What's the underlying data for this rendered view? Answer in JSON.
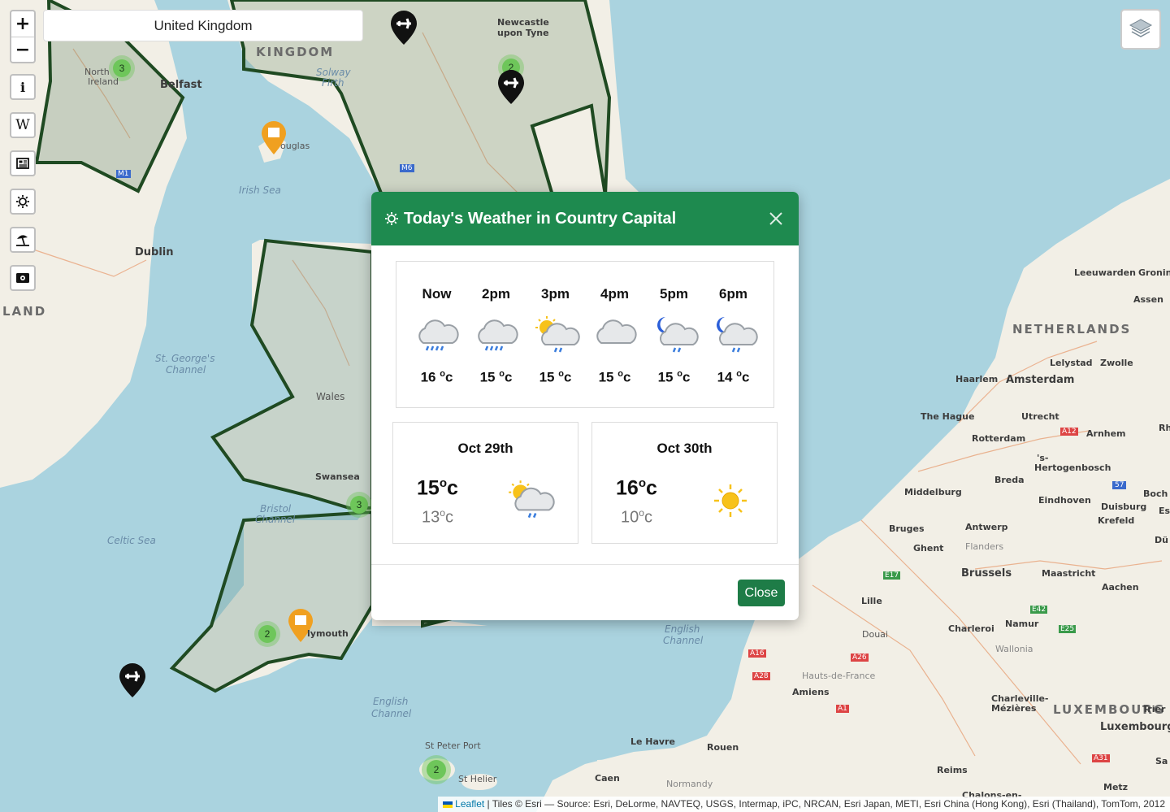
{
  "search": {
    "value": "United Kingdom"
  },
  "controls": {
    "zoom_in": "+",
    "zoom_out": "−",
    "info_label": "i",
    "wiki_label": "W"
  },
  "map_labels": {
    "kingdom": "KINGDOM",
    "land": "LAND",
    "netherlands": "NETHERLANDS",
    "luxembourg": "LUXEMBOURG",
    "newcastle_1": "Newcastle",
    "newcastle_2": "upon Tyne",
    "belfast": "Belfast",
    "north_ireland_1": "North",
    "north_ireland_2": "Ireland",
    "douglas": "ouglas",
    "solway_1": "Solway",
    "solway_2": "Firth",
    "irish_sea": "Irish Sea",
    "dublin": "Dublin",
    "st_georges_1": "St. George's",
    "st_georges_2": "Channel",
    "wales": "Wales",
    "swansea": "Swansea",
    "bristol_1": "Bristol",
    "bristol_2": "Channel",
    "celtic_sea": "Celtic Sea",
    "plymouth": "lymouth",
    "english_channel_1": "English",
    "english_channel_2": "Channel",
    "english_channel_b1": "English",
    "english_channel_b2": "Channel",
    "st_peter_port": "St Peter Port",
    "st_helier": "St Helier",
    "caen": "Caen",
    "le_havre": "Le Havre",
    "rouen": "Rouen",
    "normandy": "Normandy",
    "amiens": "Amiens",
    "hauts": "Hauts-de-France",
    "douai": "Douai",
    "lille": "Lille",
    "charleroi": "Charleroi",
    "namur": "Namur",
    "wallonia": "Wallonia",
    "reims": "Reims",
    "charleville_1": "Charleville-",
    "charleville_2": "Mézières",
    "chalons": "Chalons-en-",
    "metz": "Metz",
    "trier": "Trier",
    "luxembourg_city": "Luxembourg",
    "brussels": "Brussels",
    "maastricht": "Maastricht",
    "aachen": "Aachen",
    "bruges": "Bruges",
    "ghent": "Ghent",
    "flanders": "Flanders",
    "antwerp": "Antwerp",
    "middelburg": "Middelburg",
    "breda": "Breda",
    "eindhoven": "Eindhoven",
    "duisburg": "Duisburg",
    "krefeld": "Krefeld",
    "hertogenbosch_1": "'s-",
    "hertogenbosch_2": "Hertogenbosch",
    "rotterdam": "Rotterdam",
    "the_hague": "The Hague",
    "utrecht": "Utrecht",
    "arnhem": "Arnhem",
    "haarlem": "Haarlem",
    "amsterdam": "Amsterdam",
    "lelystad": "Lelystad",
    "zwolle": "Zwolle",
    "leeuwarden": "Leeuwarden",
    "groningen": "Gronin",
    "assen": "Assen",
    "boch": "Boch",
    "dus": "Dü",
    "rh": "Rh",
    "sa": "Sa",
    "es": "Es",
    "a12": "A12",
    "a16": "A16",
    "a26": "A26",
    "a28": "A28",
    "a1": "A1",
    "e17": "E17",
    "e42": "E42",
    "e25": "E25",
    "a31": "A31",
    "n57": "57",
    "m1": "M1",
    "m6": "M6"
  },
  "clusters": [
    {
      "count": "3"
    },
    {
      "count": "2"
    },
    {
      "count": "3"
    },
    {
      "count": "2"
    },
    {
      "count": "2"
    }
  ],
  "modal": {
    "title": "Today's Weather in Country Capital",
    "hourly": [
      {
        "time": "Now",
        "temp": "16",
        "unit": "c",
        "icon": "rain-cloud-icon"
      },
      {
        "time": "2pm",
        "temp": "15",
        "unit": "c",
        "icon": "rain-cloud-icon"
      },
      {
        "time": "3pm",
        "temp": "15",
        "unit": "c",
        "icon": "sun-cloud-rain-icon"
      },
      {
        "time": "4pm",
        "temp": "15",
        "unit": "c",
        "icon": "cloud-icon"
      },
      {
        "time": "5pm",
        "temp": "15",
        "unit": "c",
        "icon": "moon-cloud-rain-icon"
      },
      {
        "time": "6pm",
        "temp": "14",
        "unit": "c",
        "icon": "moon-cloud-rain-icon"
      }
    ],
    "days": [
      {
        "date": "Oct 29th",
        "high": "15",
        "low": "13",
        "unit": "c",
        "icon": "sun-cloud-rain-icon"
      },
      {
        "date": "Oct 30th",
        "high": "16",
        "low": "10",
        "unit": "c",
        "icon": "sun-icon"
      }
    ],
    "close_label": "Close"
  },
  "attribution": {
    "leaflet": "Leaflet",
    "text": "| Tiles © Esri — Source: Esri, DeLorme, NAVTEQ, USGS, Intermap, iPC, NRCAN, Esri Japan, METI, Esri China (Hong Kong), Esri (Thailand), TomTom, 2012"
  },
  "colors": {
    "accent": "#1e8a4f",
    "button": "#1e7c47",
    "sea": "#aad3df",
    "land": "#f2efe6",
    "border": "#1f4a22",
    "cluster": "#6ec65a",
    "poi": "#f0a020"
  }
}
